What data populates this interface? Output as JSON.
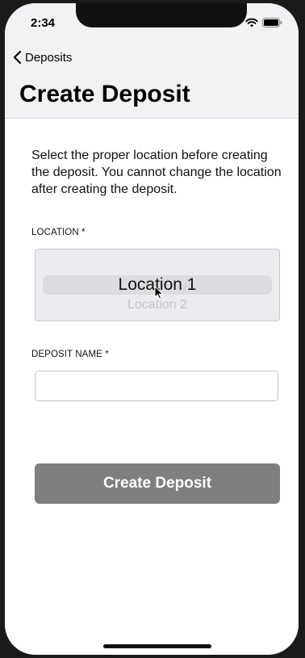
{
  "status_bar": {
    "time": "2:34",
    "signal_dots": "....",
    "icons": [
      "wifi-icon",
      "battery-icon"
    ]
  },
  "nav": {
    "back_label": "Deposits",
    "back_icon": "chevron-left-icon",
    "title": "Create Deposit"
  },
  "form": {
    "instructions": "Select the proper location before creating the deposit. You cannot change the location after creating the deposit.",
    "location_label": "LOCATION *",
    "location_picker": {
      "selected": "Location 1",
      "next": "Location 2"
    },
    "deposit_name_label": "DEPOSIT NAME *",
    "deposit_name_value": "",
    "deposit_name_placeholder": ""
  },
  "actions": {
    "create_label": "Create Deposit"
  },
  "colors": {
    "header_bg": "#f2f2f4",
    "button_bg": "#7f7f7f",
    "picker_bg": "#ececf0"
  }
}
